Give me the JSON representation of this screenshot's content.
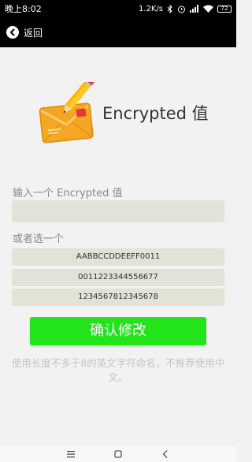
{
  "status_bar": {
    "time": "晚上8:02",
    "network_speed": "1.2K/s",
    "battery": "72"
  },
  "title_bar": {
    "back_label": "返回"
  },
  "hero": {
    "title": "Encrypted 值",
    "icon": "envelope-pencil-icon"
  },
  "form": {
    "input_label": "输入一个 Encrypted 值",
    "input_value": "",
    "input_placeholder": "",
    "or_choose_label": "或者选一个",
    "options": [
      "AABBCCDDEEFF0011",
      "0011223344556677",
      "1234567812345678"
    ],
    "confirm_label": "确认修改",
    "hint": "使用长度不多于8的英文字符命名，不推荐使用中文。"
  },
  "colors": {
    "confirm_button": "#21e41a",
    "input_background": "#e2e2d6",
    "header_background": "#000000"
  },
  "nav_bar": {
    "menu_icon": "menu-icon",
    "home_icon": "home-square-icon",
    "back_icon": "back-chevron-icon"
  }
}
